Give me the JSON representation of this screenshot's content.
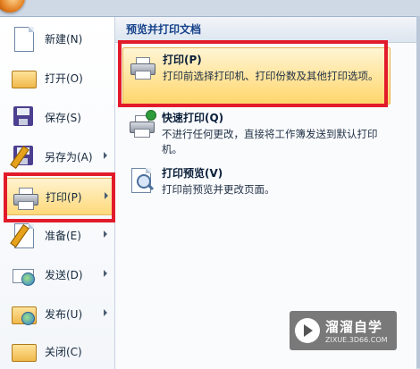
{
  "menu": {
    "items": [
      {
        "label": "新建(N)",
        "icon": "new-document-icon",
        "arrow": false
      },
      {
        "label": "打开(O)",
        "icon": "open-folder-icon",
        "arrow": false
      },
      {
        "label": "保存(S)",
        "icon": "save-disk-icon",
        "arrow": false
      },
      {
        "label": "另存为(A)",
        "icon": "save-as-icon",
        "arrow": true
      },
      {
        "label": "打印(P)",
        "icon": "printer-icon",
        "arrow": true,
        "active": true
      },
      {
        "label": "准备(E)",
        "icon": "prepare-icon",
        "arrow": true
      },
      {
        "label": "发送(D)",
        "icon": "send-icon",
        "arrow": true
      },
      {
        "label": "发布(U)",
        "icon": "publish-icon",
        "arrow": true
      },
      {
        "label": "关闭(C)",
        "icon": "close-document-icon",
        "arrow": false
      }
    ]
  },
  "submenu": {
    "header": "预览并打印文档",
    "items": [
      {
        "title": "打印(P)",
        "desc": "打印前选择打印机、打印份数及其他打印选项。",
        "icon": "printer-icon",
        "highlighted": true
      },
      {
        "title": "快速打印(Q)",
        "desc": "不进行任何更改，直接将工作簿发送到默认打印机。",
        "icon": "quick-print-icon"
      },
      {
        "title": "打印预览(V)",
        "desc": "打印前预览并更改页面。",
        "icon": "print-preview-icon"
      }
    ]
  },
  "watermark": {
    "name": "溜溜自学",
    "url": "ZIXUE.3D66.COM"
  },
  "colors": {
    "highlight": "#ffd97a",
    "annotation": "#e21b2a",
    "header_text": "#15428b"
  }
}
